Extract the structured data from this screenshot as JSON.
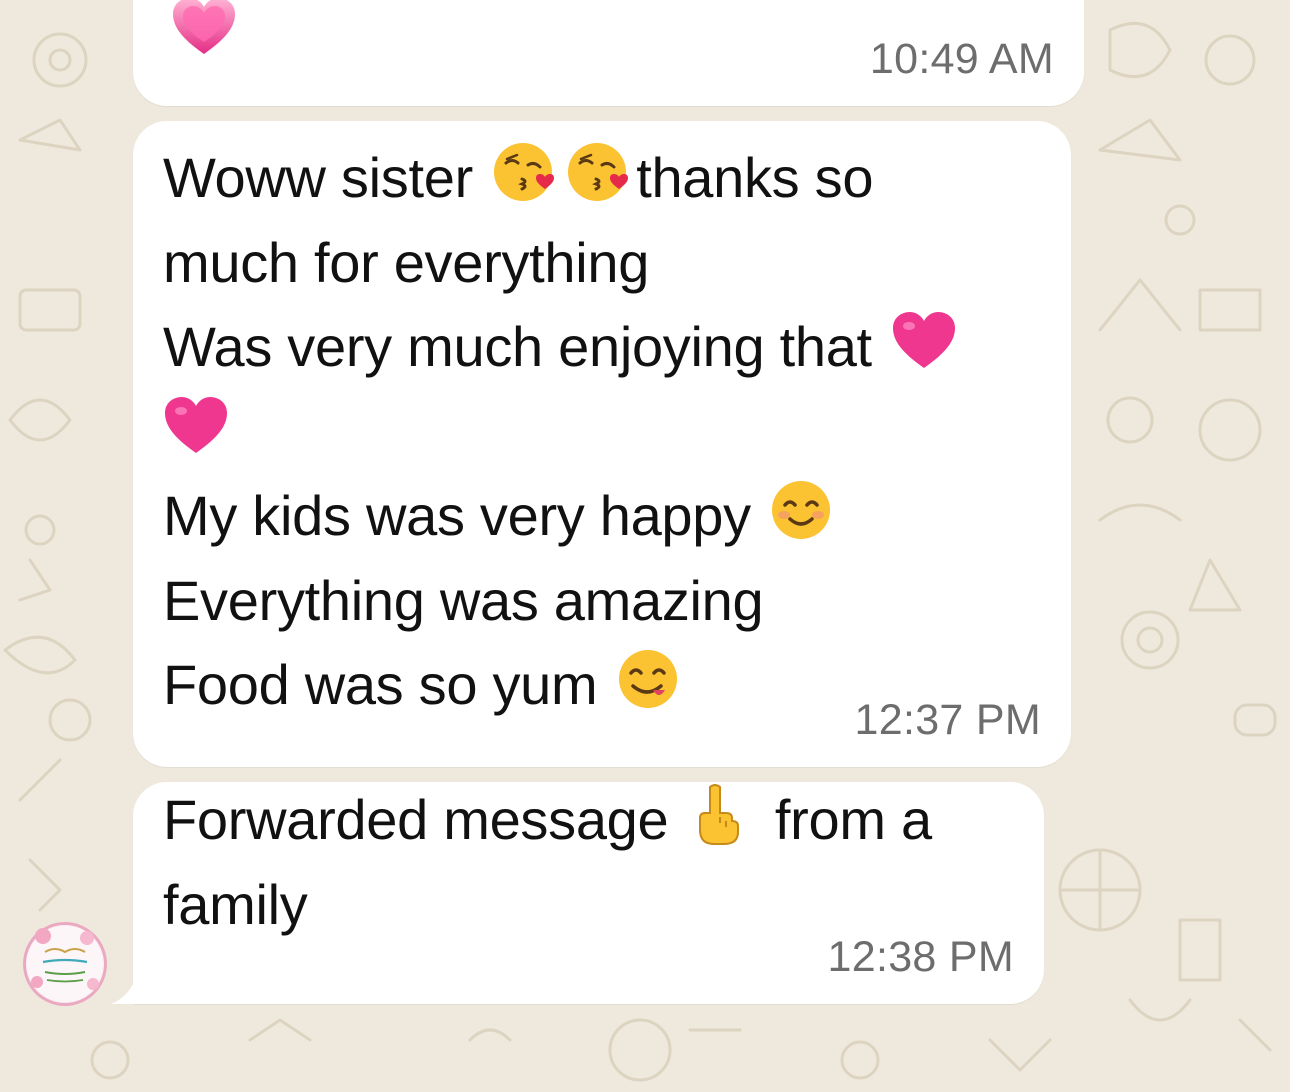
{
  "messages": [
    {
      "id": "msg-1",
      "lines": [],
      "time": "10:49 AM",
      "emojis": [
        "growing-heart-emoji"
      ]
    },
    {
      "id": "msg-2",
      "lines": [
        {
          "parts": [
            "Woww sister ",
            "",
            " ",
            "",
            "thanks so"
          ]
        },
        {
          "parts": [
            "much for everything"
          ]
        },
        {
          "parts": [
            "Was very much enjoying that "
          ]
        },
        {
          "parts": [
            ""
          ]
        },
        {
          "parts": [
            "My kids was very happy "
          ]
        },
        {
          "parts": [
            "Everything was amazing"
          ]
        },
        {
          "parts": [
            "Food was so yum "
          ]
        }
      ],
      "time": "12:37 PM"
    },
    {
      "id": "msg-3",
      "lines": [
        {
          "parts": [
            "Forwarded message ",
            " from a"
          ]
        },
        {
          "parts": [
            "family"
          ]
        }
      ],
      "time": "12:38 PM"
    }
  ],
  "sender": {
    "avatar_icon": "floral-calligraphy-avatar"
  },
  "colors": {
    "background": "#efe9dd",
    "bubble": "#ffffff",
    "text": "#111111",
    "time": "#6d6d6d",
    "heart": "#f0378f"
  }
}
